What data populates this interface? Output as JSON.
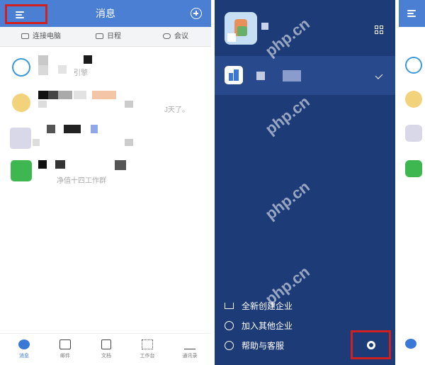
{
  "left": {
    "header": {
      "title": "消息"
    },
    "quick_actions": [
      {
        "label": "连接电脑",
        "icon": "monitor-icon"
      },
      {
        "label": "日程",
        "icon": "calendar-icon"
      },
      {
        "label": "会议",
        "icon": "cloud-meeting-icon"
      }
    ],
    "messages": [
      {
        "snippet": "引擎",
        "time": ""
      },
      {
        "snippet": "J天了。",
        "time": ""
      },
      {
        "snippet": "",
        "time": ""
      },
      {
        "snippet": "净值十四工作群",
        "time": ""
      }
    ],
    "nav": [
      {
        "label": "消息",
        "icon": "chat-bubble-icon",
        "active": true
      },
      {
        "label": "邮件",
        "icon": "mail-icon",
        "active": false
      },
      {
        "label": "文档",
        "icon": "document-icon",
        "active": false
      },
      {
        "label": "工作台",
        "icon": "grid-icon",
        "active": false
      },
      {
        "label": "通讯录",
        "icon": "org-chart-icon",
        "active": false
      }
    ],
    "colors": {
      "header": "#4a7fd4",
      "highlight": "#d02020",
      "active_nav": "#3a78d8"
    }
  },
  "right": {
    "menu": [
      {
        "label": "全新创建企业",
        "icon": "house-icon"
      },
      {
        "label": "加入其他企业",
        "icon": "plus-circle-icon"
      },
      {
        "label": "帮助与客服",
        "icon": "speech-bubble-icon"
      }
    ],
    "colors": {
      "background": "#1d3b76",
      "selected_org": "#284a8c"
    }
  },
  "watermark": "php.cn"
}
